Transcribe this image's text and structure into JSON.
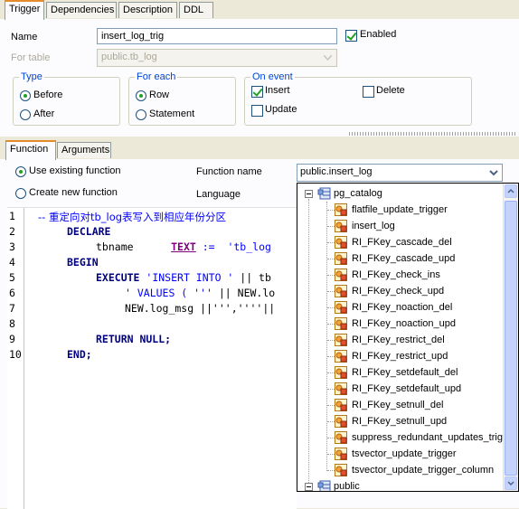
{
  "tabs": [
    "Trigger",
    "Dependencies",
    "Description",
    "DDL"
  ],
  "trigger": {
    "name_label": "Name",
    "name_value": "insert_log_trig",
    "table_label": "For table",
    "table_value": "public.tb_log",
    "enabled_label": "Enabled",
    "enabled": true
  },
  "type_group": {
    "legend": "Type",
    "before": "Before",
    "after": "After",
    "selected": "Before"
  },
  "for_each_group": {
    "legend": "For each",
    "row": "Row",
    "statement": "Statement",
    "selected": "Row"
  },
  "event_group": {
    "legend": "On event",
    "insert": "Insert",
    "delete": "Delete",
    "update": "Update",
    "insert_checked": true,
    "delete_checked": false,
    "update_checked": false
  },
  "sub_tabs": [
    "Function",
    "Arguments"
  ],
  "function_mode": {
    "use_existing": "Use existing function",
    "create_new": "Create new function",
    "selected": "use_existing"
  },
  "function_name": {
    "label": "Function name",
    "value": "public.insert_log"
  },
  "language": {
    "label": "Language"
  },
  "editor": {
    "line_numbers": [
      "1",
      "2",
      "3",
      "4",
      "5",
      "6",
      "7",
      "8",
      "9",
      "10"
    ],
    "lines": {
      "l1": "-- 重定向对tb_log表写入到相应年份分区",
      "l2": "DECLARE",
      "l3a": "tbname",
      "l3b": "TEXT",
      "l3c": ":=",
      "l3d": "'tb_log",
      "l4": "BEGIN",
      "l5a": "EXECUTE",
      "l5b": "'INSERT INTO '",
      "l5c": "|| tb",
      "l6a": "' VALUES ( '''",
      "l6b": "|| NEW.lo",
      "l7": "NEW.log_msg ||''',''''||",
      "l9": "RETURN NULL;",
      "l10": "END;"
    }
  },
  "dropdown": {
    "schema1": "pg_catalog",
    "functions": [
      "flatfile_update_trigger",
      "insert_log",
      "RI_FKey_cascade_del",
      "RI_FKey_cascade_upd",
      "RI_FKey_check_ins",
      "RI_FKey_check_upd",
      "RI_FKey_noaction_del",
      "RI_FKey_noaction_upd",
      "RI_FKey_restrict_del",
      "RI_FKey_restrict_upd",
      "RI_FKey_setdefault_del",
      "RI_FKey_setdefault_upd",
      "RI_FKey_setnull_del",
      "RI_FKey_setnull_upd",
      "suppress_redundant_updates_trigger",
      "tsvector_update_trigger",
      "tsvector_update_trigger_column"
    ],
    "schema2": "public"
  },
  "colors": {
    "accent": "#E68B2C",
    "group_legend": "#0046D5",
    "check": "#21A121",
    "keyword": "#000080",
    "comment": "#0000FF"
  }
}
